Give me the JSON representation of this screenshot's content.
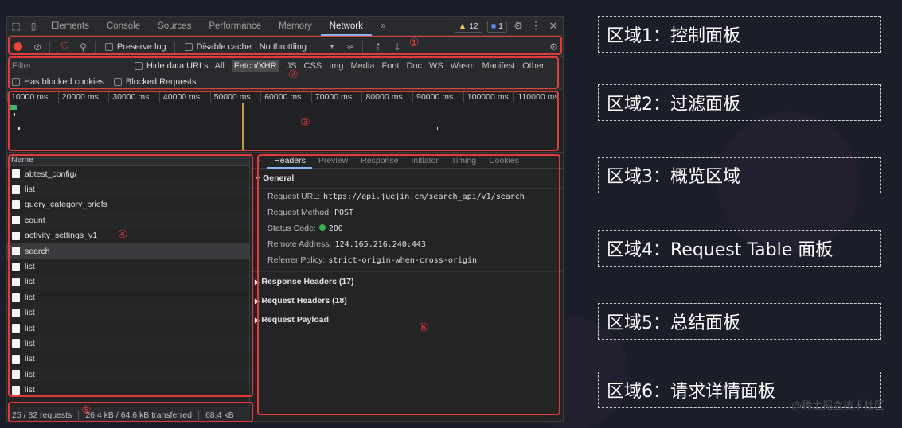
{
  "devtools": {
    "tabs": [
      "Elements",
      "Console",
      "Sources",
      "Performance",
      "Memory",
      "Network"
    ],
    "active_tab": "Network",
    "more_tabs": "»",
    "warnings_count": "12",
    "messages_count": "1",
    "toolbar": {
      "preserve_log": "Preserve log",
      "disable_cache": "Disable cache",
      "throttling": "No throttling",
      "throttling_arrow": "▼"
    },
    "filter": {
      "placeholder": "Filter",
      "hide_data_urls": "Hide data URLs",
      "types": [
        "All",
        "Fetch/XHR",
        "JS",
        "CSS",
        "Img",
        "Media",
        "Font",
        "Doc",
        "WS",
        "Wasm",
        "Manifest",
        "Other"
      ],
      "selected_type": "Fetch/XHR",
      "has_blocked_cookies": "Has blocked cookies",
      "blocked_requests": "Blocked Requests"
    },
    "overview": {
      "ticks": [
        "10000 ms",
        "20000 ms",
        "30000 ms",
        "40000 ms",
        "50000 ms",
        "60000 ms",
        "70000 ms",
        "80000 ms",
        "90000 ms",
        "100000 ms",
        "110000 ms"
      ]
    },
    "request_table": {
      "column": "Name",
      "rows": [
        "abtest_config/",
        "list",
        "query_category_briefs",
        "count",
        "activity_settings_v1",
        "search",
        "list",
        "list",
        "list",
        "list",
        "list",
        "list",
        "list",
        "list",
        "list"
      ],
      "selected_row": "search"
    },
    "details": {
      "close": "×",
      "tabs": [
        "Headers",
        "Preview",
        "Response",
        "Initiator",
        "Timing",
        "Cookies"
      ],
      "active_tab": "Headers",
      "general_title": "General",
      "general": [
        {
          "key": "Request URL:",
          "value": "https://api.juejin.cn/search_api/v1/search"
        },
        {
          "key": "Request Method:",
          "value": "POST"
        },
        {
          "key": "Status Code:",
          "value": "200"
        },
        {
          "key": "Remote Address:",
          "value": "124.165.216.240:443"
        },
        {
          "key": "Referrer Policy:",
          "value": "strict-origin-when-cross-origin"
        }
      ],
      "collapsed_sections": [
        "Response Headers (17)",
        "Request Headers (18)",
        "Request Payload"
      ]
    },
    "status_bar": {
      "requests": "25 / 82 requests",
      "transferred": "26.4 kB / 64.6 kB transferred",
      "resources": "68.4 kB"
    }
  },
  "region_markers": [
    "①",
    "②",
    "③",
    "④",
    "⑤",
    "⑥"
  ],
  "legend": [
    "区域1：控制面板",
    "区域2：过滤面板",
    "区域3：概览区域",
    "区域4：Request Table 面板",
    "区域5：总结面板",
    "区域6：请求详情面板"
  ],
  "watermark": "@稀土掘金技术社区",
  "colors": {
    "annotation_red": "#e23b3b",
    "accent_blue": "#8ab4f8",
    "record_red": "#e8453c",
    "status_green": "#37b24d"
  }
}
